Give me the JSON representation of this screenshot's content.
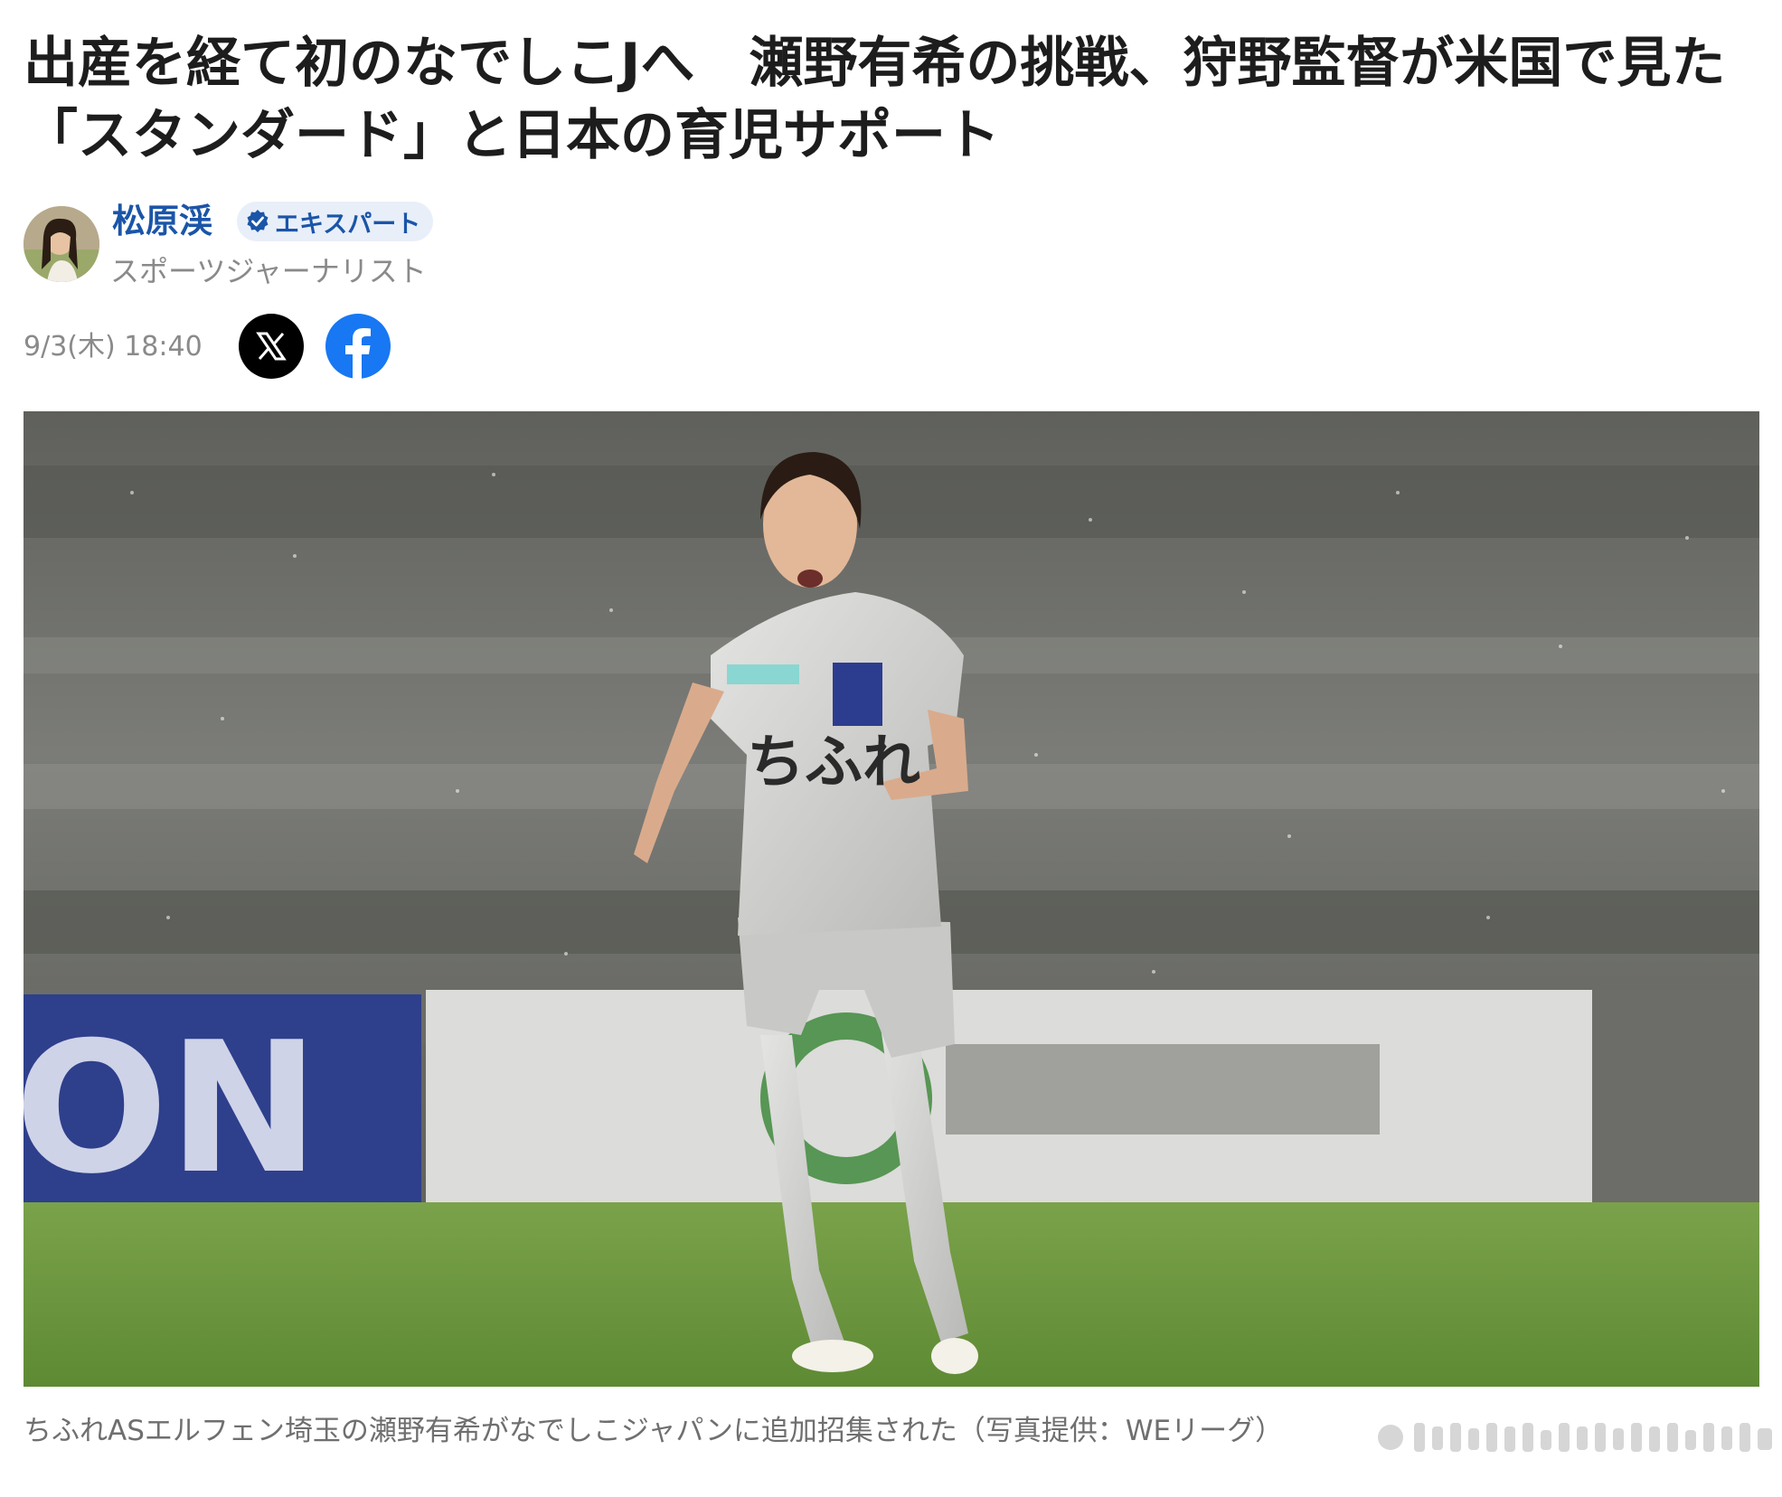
{
  "article": {
    "headline_line1": "出産を経て初のなでしこJへ　瀬野有希の挑戦、狩野監督が米国で見た",
    "headline_line2": "「スタンダード」と日本の育児サポート"
  },
  "author": {
    "name": "松原渓",
    "badge": "エキスパート",
    "title": "スポーツジャーナリスト"
  },
  "meta": {
    "date": "9/3(木) 18:40"
  },
  "share": {
    "icons": [
      "x-icon",
      "facebook-icon"
    ]
  },
  "photo": {
    "caption": "ちふれASエルフェン埼玉の瀬野有希がなでしこジャパンに追加招集された（写真提供：WEリーグ）",
    "board_text_left": "ON",
    "jersey_text": "ちふれ"
  },
  "colors": {
    "author_blue": "#1b55a8",
    "badge_bg": "#e8eff9",
    "facebook_blue": "#1877f2",
    "pitch_green": "#6e9a3e",
    "board_blue": "#2e3f8c"
  }
}
